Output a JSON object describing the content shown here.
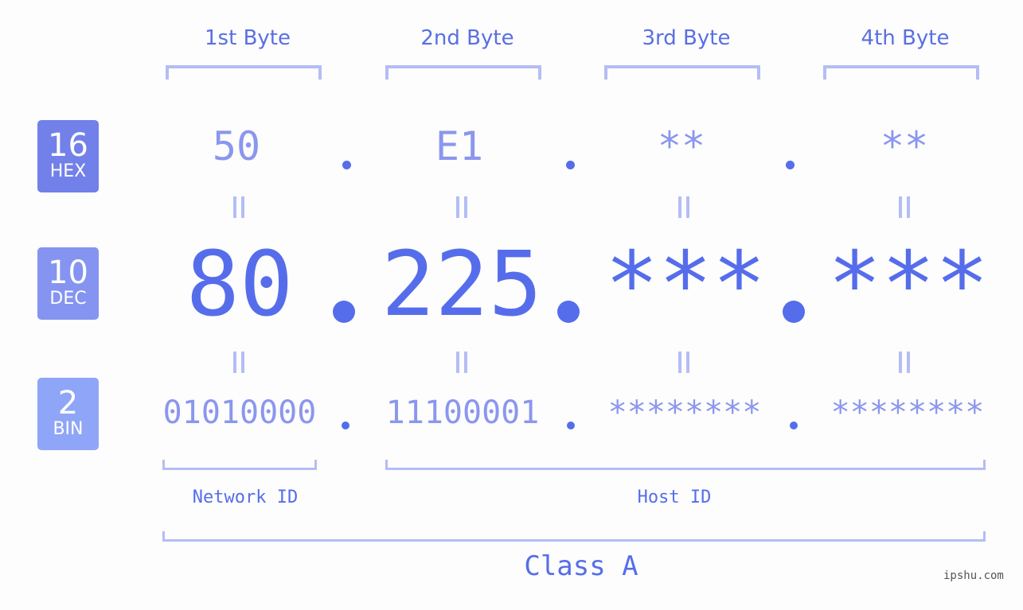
{
  "colors": {
    "hex_badge": "#7280ea",
    "dec_badge": "#8594f0",
    "bin_badge": "#8fa5f7",
    "accent": "#566deb",
    "muted": "#8b96ee",
    "bracket": "#b4bdf5"
  },
  "badges": [
    {
      "num": "16",
      "label": "HEX"
    },
    {
      "num": "10",
      "label": "DEC"
    },
    {
      "num": "2",
      "label": "BIN"
    }
  ],
  "bytes": [
    {
      "header": "1st Byte",
      "hex": "50",
      "dec": "80",
      "bin": "01010000"
    },
    {
      "header": "2nd Byte",
      "hex": "E1",
      "dec": "225",
      "bin": "11100001"
    },
    {
      "header": "3rd Byte",
      "hex": "**",
      "dec": "***",
      "bin": "********"
    },
    {
      "header": "4th Byte",
      "hex": "**",
      "dec": "***",
      "bin": "********"
    }
  ],
  "labels": {
    "network": "Network ID",
    "host": "Host ID",
    "class": "Class A"
  },
  "watermark": "ipshu.com"
}
